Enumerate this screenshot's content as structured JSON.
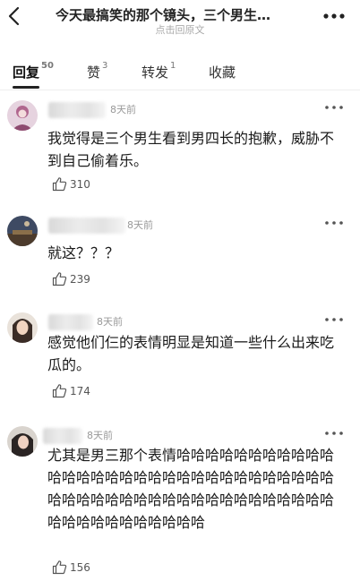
{
  "header": {
    "title": "今天最搞笑的那个镜头，三个男生…",
    "subtitle": "点击回原文"
  },
  "tabs": [
    {
      "label": "回复",
      "count": "50"
    },
    {
      "label": "赞",
      "count": "3"
    },
    {
      "label": "转发",
      "count": "1"
    },
    {
      "label": "收藏",
      "count": ""
    }
  ],
  "comments": [
    {
      "time": "8天前",
      "text": "我觉得是三个男生看到男四长的抱歉，威胁不到自己偷着乐。",
      "likes": "310"
    },
    {
      "time": "8天前",
      "text": "就这？？？",
      "likes": "239"
    },
    {
      "time": "8天前",
      "text": "感觉他们仨的表情明显是知道一些什么出来吃瓜的。",
      "likes": "174"
    },
    {
      "time": "8天前",
      "text": "尤其是男三那个表情哈哈哈哈哈哈哈哈哈哈哈哈哈哈哈哈哈哈哈哈哈哈哈哈哈哈哈哈哈哈哈哈哈哈哈哈哈哈哈哈哈哈哈哈哈哈哈哈哈哈哈哈哈哈哈哈哈哈哈哈哈哈",
      "likes": "156"
    }
  ]
}
